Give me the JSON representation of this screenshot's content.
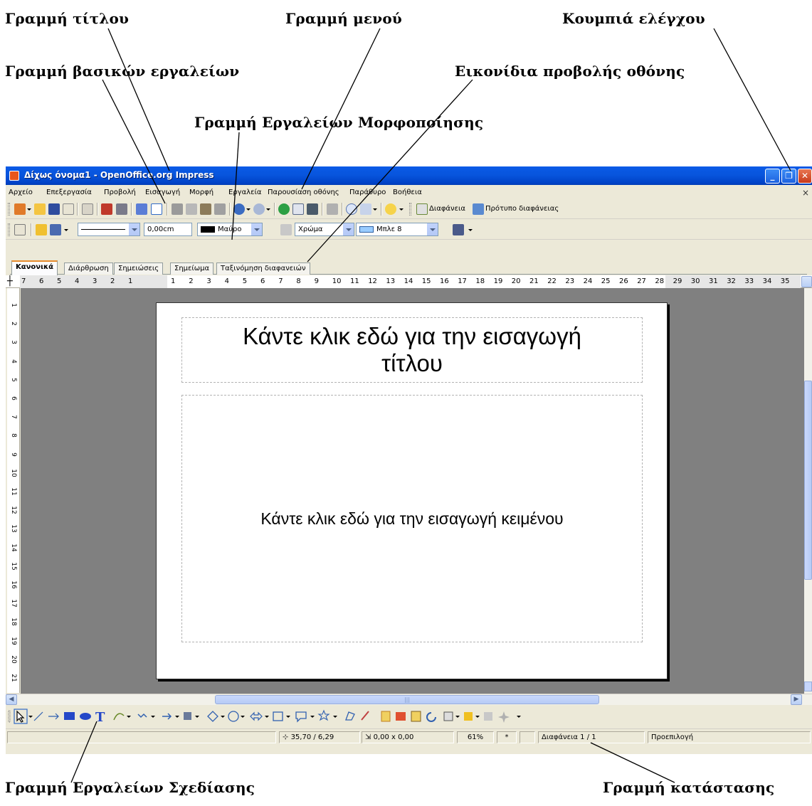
{
  "callouts": {
    "title_bar": "Γραμμή τίτλου",
    "menu_bar": "Γραμμή μενού",
    "control_buttons": "Κουμπιά ελέγχου",
    "standard_toolbar": "Γραμμή βασικών εργαλείων",
    "view_buttons": "Εικονίδια προβολής οθόνης",
    "formatting_toolbar": "Γραμμή Εργαλείων Μορφοποίησης",
    "drawing_toolbar": "Γραμμή Εργαλείων Σχεδίασης",
    "status_bar": "Γραμμή κατάστασης"
  },
  "window": {
    "title": "Δίχως όνομα1 - OpenOffice.org Impress",
    "controls": {
      "minimize": "_",
      "maximize": "❐",
      "close": "✕"
    }
  },
  "menu": {
    "items": [
      "Αρχείο",
      "Επεξεργασία",
      "Προβολή",
      "Εισαγωγή",
      "Μορφή",
      "Εργαλεία",
      "Παρουσίαση οθόνης",
      "Παράθυρο",
      "Βοήθεια"
    ],
    "close_doc": "×"
  },
  "standard_toolbar": {
    "slide_button": "Διαφάνεια",
    "master_button": "Πρότυπο διαφάνειας"
  },
  "formatting_toolbar": {
    "line_width": "0,00cm",
    "line_color": "Μαύρο",
    "line_color_hex": "#000000",
    "area_style": "Χρώμα",
    "area_color": "Μπλε 8",
    "area_color_hex": "#99ccff"
  },
  "view_tabs": [
    "Κανονικά",
    "Διάρθρωση",
    "Σημειώσεις",
    "Σημείωμα",
    "Ταξινόμηση διαφανειών"
  ],
  "rulers": {
    "horizontal_left": [
      "7",
      "6",
      "5",
      "4",
      "3",
      "2",
      "1"
    ],
    "horizontal_right": [
      "1",
      "2",
      "3",
      "4",
      "5",
      "6",
      "7",
      "8",
      "9",
      "10",
      "11",
      "12",
      "13",
      "14",
      "15",
      "16",
      "17",
      "18",
      "19",
      "20",
      "21",
      "22",
      "23",
      "24",
      "25",
      "26",
      "27",
      "28",
      "29",
      "30",
      "31",
      "32",
      "33",
      "34",
      "35"
    ],
    "vertical": [
      "1",
      "2",
      "3",
      "4",
      "5",
      "6",
      "7",
      "8",
      "9",
      "10",
      "11",
      "12",
      "13",
      "14",
      "15",
      "16",
      "17",
      "18",
      "19",
      "20",
      "21"
    ]
  },
  "slide": {
    "title_placeholder": "Κάντε κλικ εδώ για την εισαγωγή τίτλου",
    "body_placeholder": "Κάντε κλικ εδώ για την εισαγωγή κειμένου"
  },
  "scrollbar": {
    "thumb_grip": "|||"
  },
  "status": {
    "position": "35,70 / 6,29",
    "size": "0,00 x 0,00",
    "zoom": "61%",
    "modified": "*",
    "slide": "Διαφάνεια 1 / 1",
    "layout": "Προεπιλογή"
  },
  "colors": {
    "titlebar": "#0a5ae6",
    "window_bg": "#ece9d8",
    "canvas_bg": "#808080",
    "active_tab_accent": "#e68b2c"
  }
}
